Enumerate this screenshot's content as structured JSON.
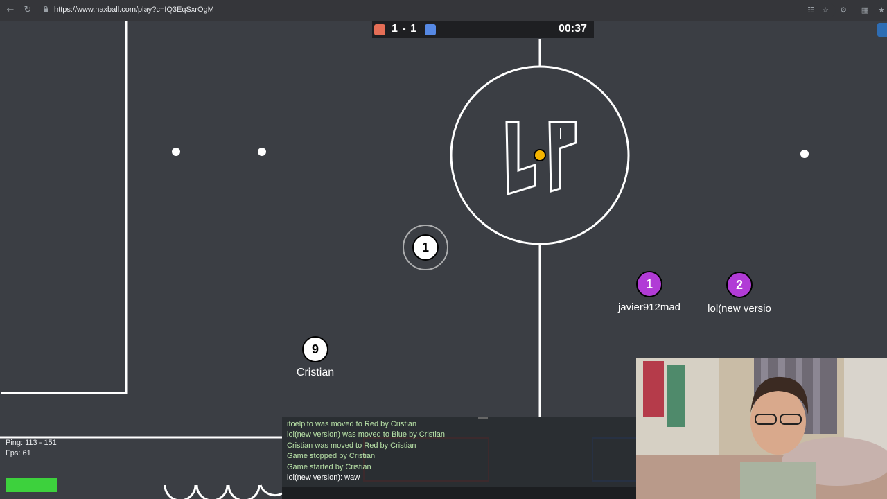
{
  "browser": {
    "url": "https://www.haxball.com/play?c=IQ3EqSxrOgM",
    "icons": [
      "back-arrow-icon",
      "reload-icon",
      "lock-icon",
      "translate-icon",
      "star-icon",
      "extensions-icon",
      "puzzle-icon",
      "bookmark-icon"
    ]
  },
  "scoreboard": {
    "score": "1 - 1",
    "timer": "00:37",
    "red_color": "#e56e56",
    "blue_color": "#5689e5"
  },
  "field": {
    "background": "#3b3e44",
    "line_color": "#ffffff",
    "ball_color": "#f4b400",
    "red_player_color": "#ffffff",
    "purple_player_color": "#b13bd6"
  },
  "players": [
    {
      "number": "1",
      "name": "",
      "team": "white-highlight"
    },
    {
      "number": "9",
      "name": "Cristian",
      "team": "white"
    },
    {
      "number": "1",
      "name": "javier912mad",
      "team": "purple"
    },
    {
      "number": "2",
      "name": "lol(new versio",
      "team": "purple"
    }
  ],
  "chat": [
    {
      "text": "itoelpito was moved to Red by Cristian",
      "kind": "notice"
    },
    {
      "text": "lol(new version) was moved to Blue by Cristian",
      "kind": "notice"
    },
    {
      "text": "Cristian was moved to Red by Cristian",
      "kind": "notice"
    },
    {
      "text": "Game stopped by Cristian",
      "kind": "notice"
    },
    {
      "text": "Game started by Cristian",
      "kind": "notice"
    },
    {
      "text": "lol(new version): waw",
      "kind": "player"
    }
  ],
  "stats": {
    "ping": "Ping: 113 - 151",
    "fps": "Fps: 61"
  }
}
